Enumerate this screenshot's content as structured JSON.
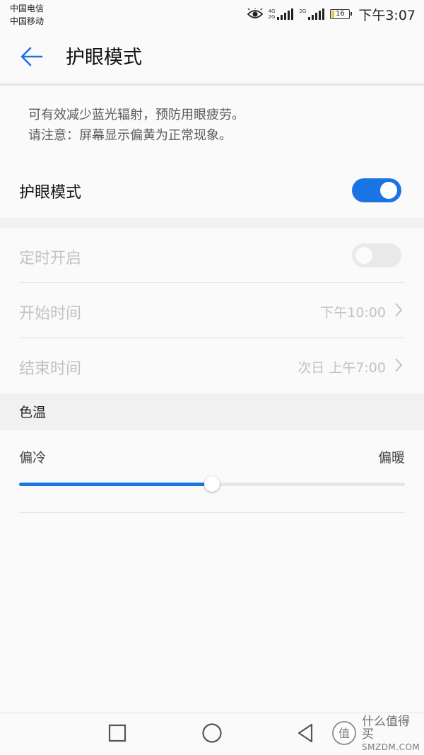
{
  "status_bar": {
    "carrier_1": "中国电信",
    "carrier_2": "中国移动",
    "network_1_top": "4G",
    "network_1_bottom": "2G",
    "network_2": "2G",
    "battery_level": "16",
    "battery_percent": 16,
    "time": "下午3:07",
    "icons": [
      "eye-icon",
      "signal-icon",
      "battery-icon"
    ]
  },
  "header": {
    "title": "护眼模式",
    "back_icon": "back-arrow-icon"
  },
  "description": {
    "line1": "可有效减少蓝光辐射，预防用眼疲劳。",
    "line2": "请注意：屏幕显示偏黄为正常现象。"
  },
  "eye_mode": {
    "label": "护眼模式",
    "enabled": true
  },
  "schedule": {
    "label": "定时开启",
    "enabled": false,
    "start": {
      "label": "开始时间",
      "value": "下午10:00"
    },
    "end": {
      "label": "结束时间",
      "value": "次日 上午7:00"
    }
  },
  "color_temp": {
    "section_title": "色温",
    "cold_label": "偏冷",
    "warm_label": "偏暖",
    "level_fraction": 0.5
  },
  "nav_bar": {
    "icons": [
      "recent-apps-icon",
      "home-icon",
      "back-icon"
    ]
  },
  "watermark": {
    "logo_char": "值",
    "text_cn": "什么值得买",
    "text_en": "SMZDM.COM"
  },
  "colors": {
    "accent": "#1b74e4",
    "disabled_text": "#c2c2c2",
    "section_bg": "#f1f1f1",
    "page_bg": "#fafafa"
  }
}
